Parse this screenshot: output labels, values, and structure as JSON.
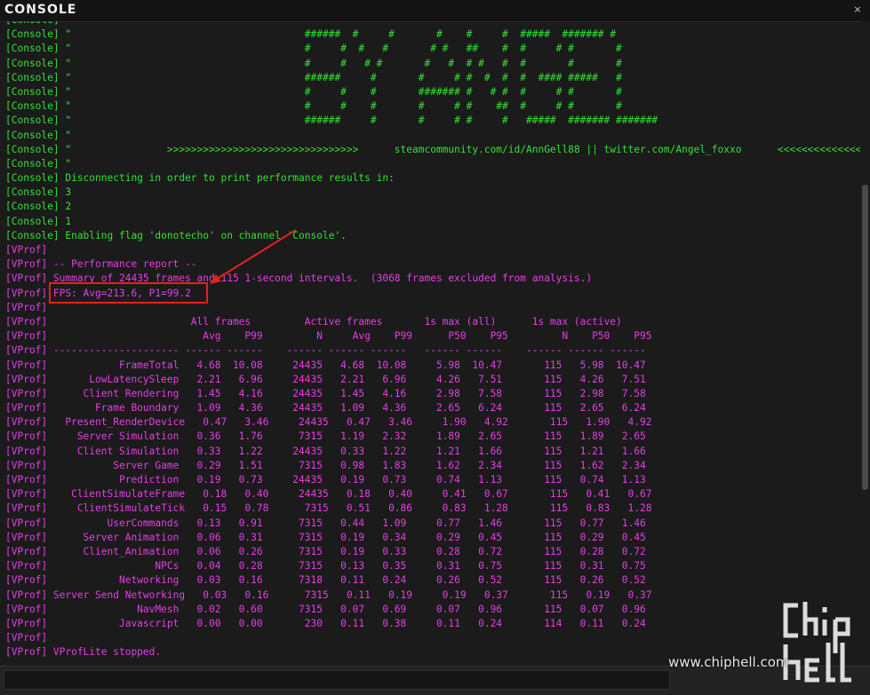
{
  "window": {
    "title": "CONSOLE",
    "close_glyph": "×"
  },
  "log_lines": [
    {
      "text": "[Console]",
      "channel": "console"
    },
    {
      "text": "[Console] \"                                       ######  #     #       #    #     #  #####  ####### #",
      "channel": "console"
    },
    {
      "text": "[Console] \"                                       #     #  #   #       # #   ##    #  #     # #       #",
      "channel": "console"
    },
    {
      "text": "[Console] \"                                       #     #   # #       #   #  # #   #  #       #       #",
      "channel": "console"
    },
    {
      "text": "[Console] \"                                       ######     #       #     # #  #  #  #  #### #####   #",
      "channel": "console"
    },
    {
      "text": "[Console] \"                                       #     #    #       ####### #   # #  #     # #       #",
      "channel": "console"
    },
    {
      "text": "[Console] \"                                       #     #    #       #     # #    ##  #     # #       #",
      "channel": "console"
    },
    {
      "text": "[Console] \"                                       ######     #       #     # #     #   #####  ####### #######",
      "channel": "console"
    },
    {
      "text": "[Console] \"",
      "channel": "console"
    },
    {
      "text": "[Console] \"                >>>>>>>>>>>>>>>>>>>>>>>>>>>>>>>>      steamcommunity.com/id/AnnGell88 || twitter.com/Angel_foxxo      <<<<<<<<<<<<<<<<<<<<<<<<<<<<<<<<",
      "channel": "console"
    },
    {
      "text": "[Console] \"",
      "channel": "console"
    },
    {
      "text": "[Console] Disconnecting in order to print performance results in:",
      "channel": "console"
    },
    {
      "text": "[Console] 3",
      "channel": "console"
    },
    {
      "text": "[Console] 2",
      "channel": "console"
    },
    {
      "text": "[Console] 1",
      "channel": "console"
    },
    {
      "text": "[Console] Enabling flag 'donotecho' on channel 'Console'.",
      "channel": "console"
    },
    {
      "text": "[VProf]",
      "channel": "vprof"
    },
    {
      "text": "[VProf] -- Performance report --",
      "channel": "vprof"
    },
    {
      "text": "[VProf] Summary of 24435 frames and 115 1-second intervals.  (3068 frames excluded from analysis.)",
      "channel": "vprof"
    },
    {
      "text": "[VProf] FPS: Avg=213.6, P1=99.2",
      "channel": "vprof"
    },
    {
      "text": "[VProf]",
      "channel": "vprof"
    },
    {
      "text": "[VProf]                        All frames         Active frames       1s max (all)      1s max (active)",
      "channel": "vprof"
    },
    {
      "text": "[VProf]                          Avg    P99         N     Avg    P99      P50    P95         N    P50    P95",
      "channel": "vprof"
    },
    {
      "text": "[VProf] --------------------- ------ ------    ------ ------ ------   ------ ------    ------ ------ ------",
      "channel": "vprof"
    },
    {
      "text": "[VProf]            FrameTotal   4.68  10.08     24435   4.68  10.08     5.98  10.47       115   5.98  10.47",
      "channel": "vprof"
    },
    {
      "text": "[VProf]       LowLatencySleep   2.21   6.96     24435   2.21   6.96     4.26   7.51       115   4.26   7.51",
      "channel": "vprof"
    },
    {
      "text": "[VProf]      Client Rendering   1.45   4.16     24435   1.45   4.16     2.98   7.58       115   2.98   7.58",
      "channel": "vprof"
    },
    {
      "text": "[VProf]        Frame Boundary   1.09   4.36     24435   1.09   4.36     2.65   6.24       115   2.65   6.24",
      "channel": "vprof"
    },
    {
      "text": "[VProf]   Present_RenderDevice   0.47   3.46     24435   0.47   3.46     1.90   4.92       115   1.90   4.92",
      "channel": "vprof"
    },
    {
      "text": "[VProf]     Server Simulation   0.36   1.76      7315   1.19   2.32     1.89   2.65       115   1.89   2.65",
      "channel": "vprof"
    },
    {
      "text": "[VProf]     Client Simulation   0.33   1.22     24435   0.33   1.22     1.21   1.66       115   1.21   1.66",
      "channel": "vprof"
    },
    {
      "text": "[VProf]           Server Game   0.29   1.51      7315   0.98   1.83     1.62   2.34       115   1.62   2.34",
      "channel": "vprof"
    },
    {
      "text": "[VProf]            Prediction   0.19   0.73     24435   0.19   0.73     0.74   1.13       115   0.74   1.13",
      "channel": "vprof"
    },
    {
      "text": "[VProf]    ClientSimulateFrame   0.18   0.40     24435   0.18   0.40     0.41   0.67       115   0.41   0.67",
      "channel": "vprof"
    },
    {
      "text": "[VProf]     ClientSimulateTick   0.15   0.78      7315   0.51   0.86     0.83   1.28       115   0.83   1.28",
      "channel": "vprof"
    },
    {
      "text": "[VProf]          UserCommands   0.13   0.91      7315   0.44   1.09     0.77   1.46       115   0.77   1.46",
      "channel": "vprof"
    },
    {
      "text": "[VProf]      Server Animation   0.06   0.31      7315   0.19   0.34     0.29   0.45       115   0.29   0.45",
      "channel": "vprof"
    },
    {
      "text": "[VProf]      Client_Animation   0.06   0.26      7315   0.19   0.33     0.28   0.72       115   0.28   0.72",
      "channel": "vprof"
    },
    {
      "text": "[VProf]                  NPCs   0.04   0.28      7315   0.13   0.35     0.31   0.75       115   0.31   0.75",
      "channel": "vprof"
    },
    {
      "text": "[VProf]            Networking   0.03   0.16      7318   0.11   0.24     0.26   0.52       115   0.26   0.52",
      "channel": "vprof"
    },
    {
      "text": "[VProf] Server Send Networking   0.03   0.16      7315   0.11   0.19     0.19   0.37       115   0.19   0.37",
      "channel": "vprof"
    },
    {
      "text": "[VProf]               NavMesh   0.02   0.60      7315   0.07   0.69     0.07   0.96       115   0.07   0.96",
      "channel": "vprof"
    },
    {
      "text": "[VProf]            Javascript   0.00   0.00       230   0.11   0.38     0.11   0.24       114   0.11   0.24",
      "channel": "vprof"
    },
    {
      "text": "[VProf]",
      "channel": "vprof"
    },
    {
      "text": "[VProf] VProfLite stopped.",
      "channel": "vprof"
    }
  ],
  "command_input": {
    "value": "",
    "placeholder": ""
  },
  "watermark": {
    "site": "www.chiphell.com",
    "logo_text": "chip hell"
  },
  "colors": {
    "console_text": "#35e035",
    "vprof_text": "#e63ee6",
    "background": "#1b1b1b",
    "annotation_red": "#e8201c"
  }
}
